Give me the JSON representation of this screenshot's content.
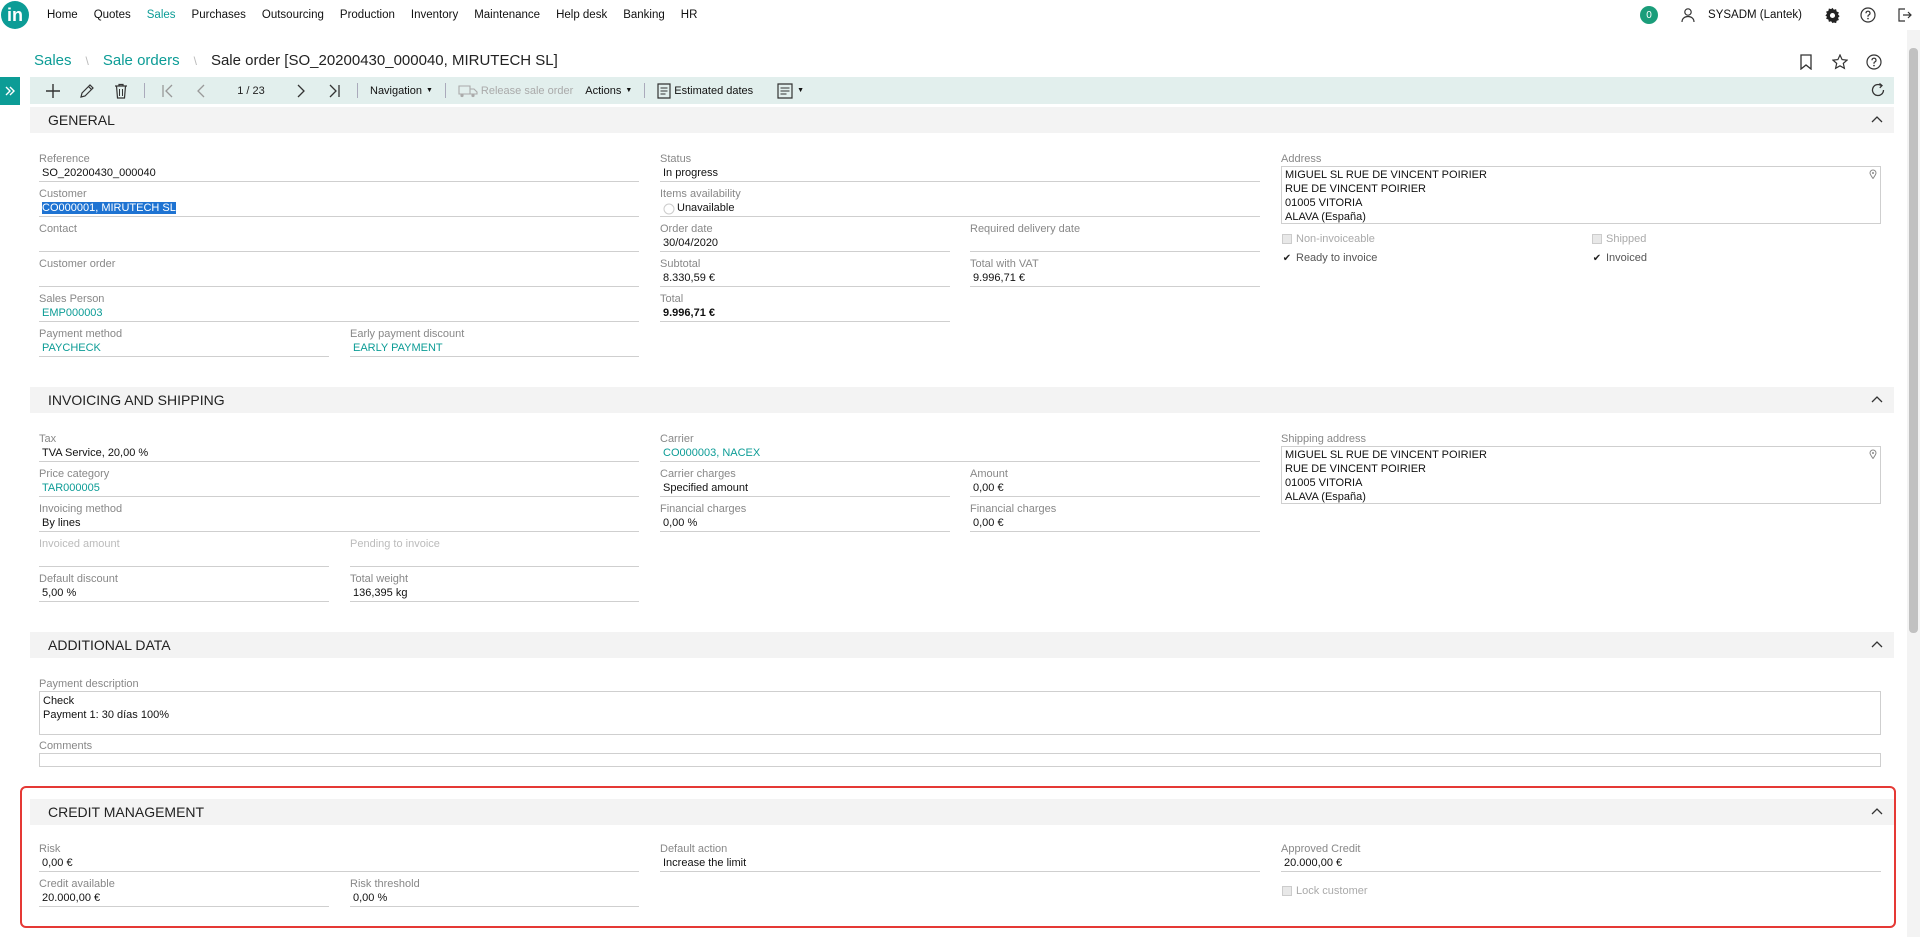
{
  "menu": {
    "items": [
      {
        "label": "Home",
        "active": false
      },
      {
        "label": "Quotes",
        "active": false
      },
      {
        "label": "Sales",
        "active": true
      },
      {
        "label": "Purchases",
        "active": false
      },
      {
        "label": "Outsourcing",
        "active": false
      },
      {
        "label": "Production",
        "active": false
      },
      {
        "label": "Inventory",
        "active": false
      },
      {
        "label": "Maintenance",
        "active": false
      },
      {
        "label": "Help desk",
        "active": false
      },
      {
        "label": "Banking",
        "active": false
      },
      {
        "label": "HR",
        "active": false
      }
    ],
    "logo": "in",
    "notifications": "0",
    "user": "SYSADM (Lantek)"
  },
  "breadcrumb": {
    "sales": "Sales",
    "sale_orders": "Sale orders",
    "title": "Sale order [SO_20200430_000040, MIRUTECH SL]"
  },
  "toolbar": {
    "pager": "1 / 23",
    "navigation": "Navigation",
    "release": "Release sale order",
    "actions": "Actions",
    "estimated_dates": "Estimated dates"
  },
  "general": {
    "title": "GENERAL",
    "reference": {
      "label": "Reference",
      "value": "SO_20200430_000040"
    },
    "customer": {
      "label": "Customer",
      "value": "CO000001, MIRUTECH SL"
    },
    "contact": {
      "label": "Contact",
      "value": ""
    },
    "customer_order": {
      "label": "Customer order",
      "value": ""
    },
    "sales_person": {
      "label": "Sales Person",
      "value": "EMP000003"
    },
    "payment_method": {
      "label": "Payment method",
      "value": "PAYCHECK"
    },
    "early_payment": {
      "label": "Early payment discount",
      "value": "EARLY PAYMENT"
    },
    "status": {
      "label": "Status",
      "value": "In progress"
    },
    "items_availability": {
      "label": "Items availability",
      "value": "Unavailable"
    },
    "order_date": {
      "label": "Order date",
      "value": "30/04/2020"
    },
    "required_delivery": {
      "label": "Required delivery date",
      "value": ""
    },
    "subtotal": {
      "label": "Subtotal",
      "value": "8.330,59 €"
    },
    "total_vat": {
      "label": "Total with VAT",
      "value": "9.996,71 €"
    },
    "total": {
      "label": "Total",
      "value": "9.996,71 €"
    },
    "address": {
      "label": "Address",
      "lines": [
        "MIGUEL SL RUE DE VINCENT POIRIER",
        "RUE DE VINCENT POIRIER",
        "01005  VITORIA",
        "ALAVA  (España)"
      ]
    },
    "non_invoiceable": "Non-invoiceable",
    "shipped": "Shipped",
    "ready_to_invoice": "Ready to invoice",
    "invoiced": "Invoiced"
  },
  "invoicing": {
    "title": "INVOICING AND SHIPPING",
    "tax": {
      "label": "Tax",
      "value": "TVA Service, 20,00 %"
    },
    "price_category": {
      "label": "Price category",
      "value": "TAR000005"
    },
    "invoicing_method": {
      "label": "Invoicing method",
      "value": "By lines"
    },
    "invoiced_amount": {
      "label": "Invoiced amount",
      "value": ""
    },
    "pending_invoice": {
      "label": "Pending to invoice",
      "value": ""
    },
    "default_discount": {
      "label": "Default discount",
      "value": "5,00 %"
    },
    "total_weight": {
      "label": "Total weight",
      "value": "136,395 kg"
    },
    "carrier": {
      "label": "Carrier",
      "value": "CO000003, NACEX"
    },
    "carrier_charges": {
      "label": "Carrier charges",
      "value": "Specified amount"
    },
    "amount": {
      "label": "Amount",
      "value": "0,00 €"
    },
    "financial_charges_1": {
      "label": "Financial charges",
      "value": "0,00 %"
    },
    "financial_charges_2": {
      "label": "Financial charges",
      "value": "0,00 €"
    },
    "shipping_address": {
      "label": "Shipping address",
      "lines": [
        "MIGUEL SL RUE DE VINCENT POIRIER",
        "RUE DE VINCENT POIRIER",
        "01005  VITORIA",
        "ALAVA  (España)"
      ]
    }
  },
  "additional": {
    "title": "ADDITIONAL DATA",
    "payment_description": {
      "label": "Payment description",
      "lines": [
        "Check",
        "Payment 1: 30 días 100%"
      ]
    },
    "comments": {
      "label": "Comments",
      "value": ""
    }
  },
  "credit": {
    "title": "CREDIT MANAGEMENT",
    "risk": {
      "label": "Risk",
      "value": "0,00 €"
    },
    "credit_available": {
      "label": "Credit available",
      "value": "20.000,00 €"
    },
    "risk_threshold": {
      "label": "Risk threshold",
      "value": "0,00 %"
    },
    "default_action": {
      "label": "Default action",
      "value": "Increase the limit"
    },
    "approved_credit": {
      "label": "Approved Credit",
      "value": "20.000,00 €"
    },
    "lock_customer": "Lock customer"
  },
  "colors": {
    "accent": "#0c9c96",
    "highlight": "#e53935"
  }
}
